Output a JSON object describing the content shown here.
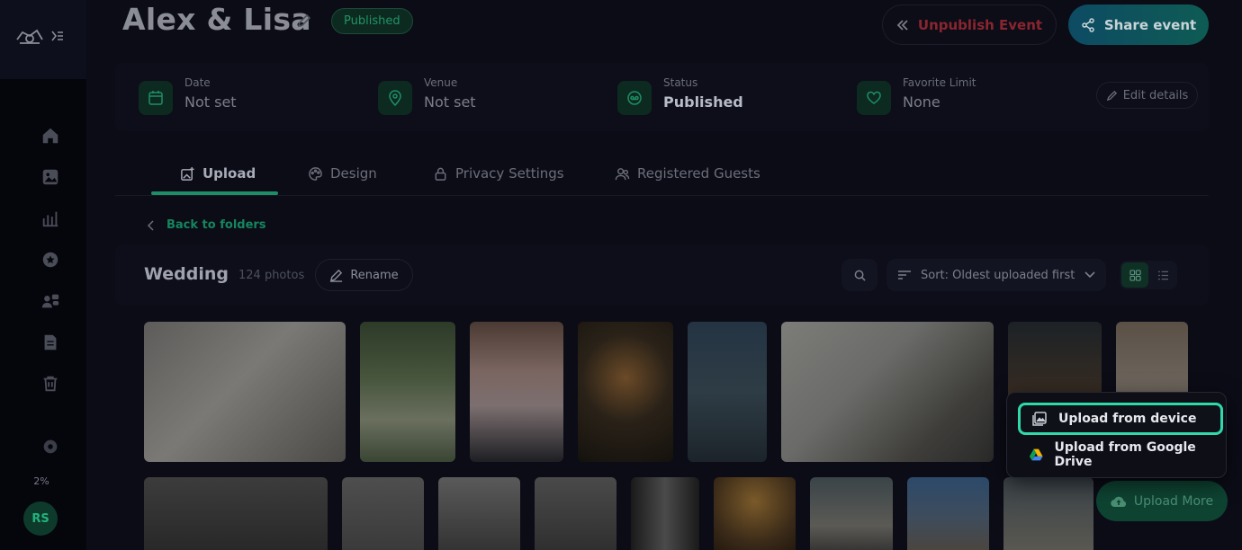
{
  "header": {
    "title": "Alex & Lisa",
    "status_badge": "Published",
    "unpublish_label": "Unpublish Event",
    "share_label": "Share event"
  },
  "info": {
    "date": {
      "label": "Date",
      "value": "Not set"
    },
    "venue": {
      "label": "Venue",
      "value": "Not set"
    },
    "status": {
      "label": "Status",
      "value": "Published"
    },
    "favorite_limit": {
      "label": "Favorite Limit",
      "value": "None"
    },
    "edit_label": "Edit details"
  },
  "tabs": [
    {
      "label": "Upload",
      "icon": "image-plus-icon",
      "active": true
    },
    {
      "label": "Design",
      "icon": "palette-icon",
      "active": false
    },
    {
      "label": "Privacy Settings",
      "icon": "lock-icon",
      "active": false
    },
    {
      "label": "Registered Guests",
      "icon": "users-icon",
      "active": false
    }
  ],
  "back_link": "Back to folders",
  "folder": {
    "name": "Wedding",
    "count": "124 photos",
    "rename_label": "Rename",
    "sort_label": "Sort: Oldest uploaded first"
  },
  "sidebar": {
    "items": [
      "home-icon",
      "gallery-icon",
      "analytics-icon",
      "star-icon",
      "team-icon",
      "document-icon",
      "trash-icon",
      "settings-icon"
    ],
    "storage_percent": "2%",
    "avatar_initials": "RS"
  },
  "upload_menu": {
    "device_label": "Upload from device",
    "drive_label": "Upload from Google Drive"
  },
  "upload_more_label": "Upload More",
  "colors": {
    "accent": "#2fd9a9",
    "brand_green": "#1e8e66",
    "danger": "#8a2530",
    "background": "#0b0c16"
  }
}
